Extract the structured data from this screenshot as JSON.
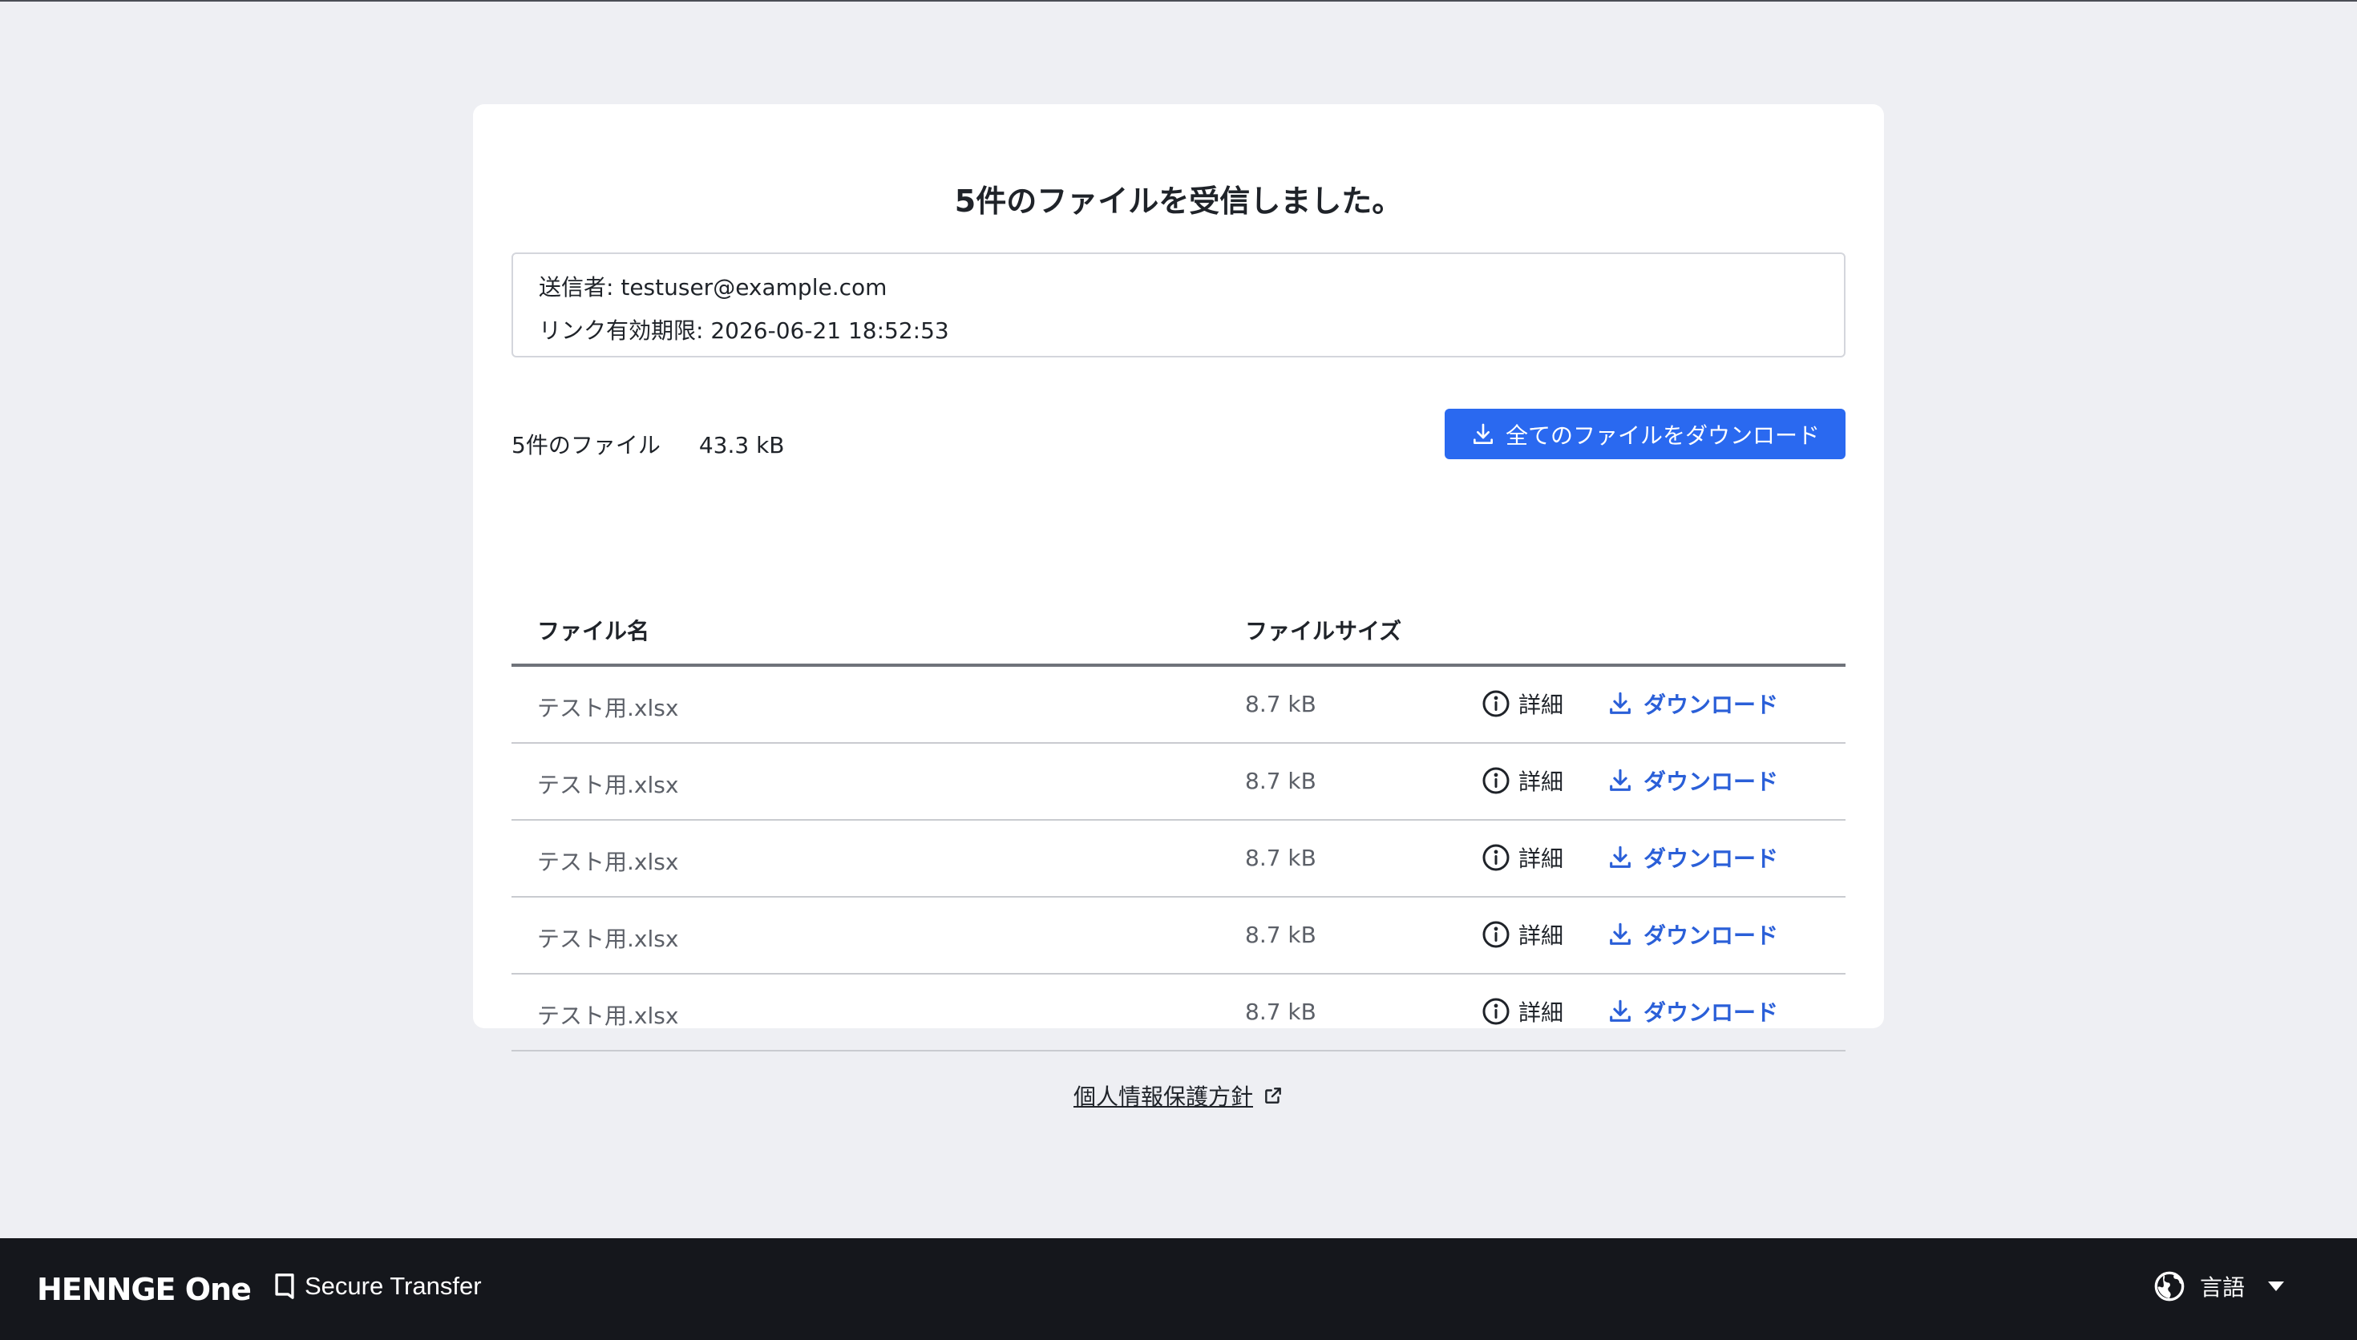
{
  "header": {
    "title": "5件のファイルを受信しました。"
  },
  "info": {
    "sender_label": "送信者:",
    "sender": "testuser@example.com",
    "expiry_label": "リンク有効期限:",
    "expiry": "2026-06-21 18:52:53"
  },
  "summary": {
    "count": "5件のファイル",
    "total_size": "43.3 kB"
  },
  "actions": {
    "download_all": "全てのファイルをダウンロード"
  },
  "table": {
    "columns": {
      "name": "ファイル名",
      "size": "ファイルサイズ"
    },
    "detail_label": "詳細",
    "download_label": "ダウンロード",
    "rows": [
      {
        "name": "テスト用.xlsx",
        "size": "8.7 kB"
      },
      {
        "name": "テスト用.xlsx",
        "size": "8.7 kB"
      },
      {
        "name": "テスト用.xlsx",
        "size": "8.7 kB"
      },
      {
        "name": "テスト用.xlsx",
        "size": "8.7 kB"
      },
      {
        "name": "テスト用.xlsx",
        "size": "8.7 kB"
      }
    ]
  },
  "links": {
    "privacy": "個人情報保護方針"
  },
  "footer": {
    "brand": "HENNGE One",
    "product": "Secure Transfer",
    "language": "言語"
  },
  "colors": {
    "accent": "#2a69f0",
    "link": "#2a5fd8",
    "footer_bg": "#15171c",
    "page_bg": "#eeeff3"
  }
}
